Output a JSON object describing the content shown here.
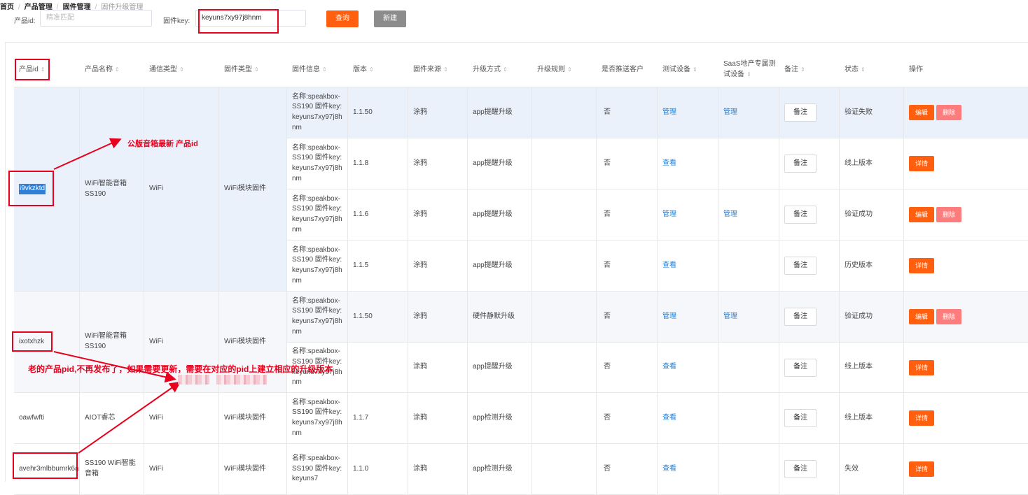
{
  "breadcrumb": {
    "home": "首页",
    "products": "产品管理",
    "firmware": "固件管理",
    "current": "固件升级管理"
  },
  "filters": {
    "product_id_label": "产品id:",
    "product_id_placeholder": "精准匹配",
    "firmware_key_label": "固件key:",
    "firmware_key_value": "keyuns7xy97j8hnm",
    "query_label": "查询",
    "new_label": "新建"
  },
  "columns": [
    "产品id",
    "产品名称",
    "通信类型",
    "固件类型",
    "固件信息",
    "版本",
    "固件来源",
    "升级方式",
    "升级规则",
    "是否推送客户",
    "测试设备",
    "SaaS地产专属测试设备",
    "备注",
    "状态",
    "操作"
  ],
  "groups": [
    {
      "pid": "i9vkzktd",
      "name": "WiFi智能音箱 SS190",
      "comm": "WiFi",
      "fwtype": "WiFi模块固件"
    },
    {
      "pid": "ixotxhzk",
      "name": "WiFi智能音箱SS190",
      "comm": "WiFi",
      "fwtype": "WiFi模块固件"
    },
    {
      "pid": "oawfwfti",
      "name": "AIOT睿芯",
      "comm": "WiFi",
      "fwtype": "WiFi模块固件"
    },
    {
      "pid": "avehr3mlbbumrk6a",
      "name": "SS190 WiFi智能音箱",
      "comm": "WiFi",
      "fwtype": "WiFi模块固件"
    }
  ],
  "rows": [
    {
      "info": "名称:speakbox-SS190 固件key:keyuns7xy97j8hnm",
      "version": "1.1.50",
      "source": "涂鸦",
      "method": "app提醒升级",
      "rule": "",
      "push": "否",
      "test": "管理",
      "saas": "管理",
      "remark": "备注",
      "status": "验证失败",
      "ops": [
        "编辑",
        "删除"
      ]
    },
    {
      "info": "名称:speakbox-SS190 固件key:keyuns7xy97j8hnm",
      "version": "1.1.8",
      "source": "涂鸦",
      "method": "app提醒升级",
      "rule": "",
      "push": "否",
      "test": "查看",
      "saas": "",
      "remark": "备注",
      "status": "线上版本",
      "ops": [
        "详情"
      ]
    },
    {
      "info": "名称:speakbox-SS190 固件key:keyuns7xy97j8hnm",
      "version": "1.1.6",
      "source": "涂鸦",
      "method": "app提醒升级",
      "rule": "",
      "push": "否",
      "test": "管理",
      "saas": "管理",
      "remark": "备注",
      "status": "验证成功",
      "ops": [
        "编辑",
        "删除"
      ]
    },
    {
      "info": "名称:speakbox-SS190 固件key:keyuns7xy97j8hnm",
      "version": "1.1.5",
      "source": "涂鸦",
      "method": "app提醒升级",
      "rule": "",
      "push": "否",
      "test": "查看",
      "saas": "",
      "remark": "备注",
      "status": "历史版本",
      "ops": [
        "详情"
      ]
    },
    {
      "info": "名称:speakbox-SS190 固件key:keyuns7xy97j8hnm",
      "version": "1.1.50",
      "source": "涂鸦",
      "method": "硬件静默升级",
      "rule": "",
      "push": "否",
      "test": "管理",
      "saas": "管理",
      "remark": "备注",
      "status": "验证成功",
      "ops": [
        "编辑",
        "删除"
      ]
    },
    {
      "info": "名称:speakbox-SS190 固件key:keyuns7xy97j8hnm",
      "version": "",
      "source": "涂鸦",
      "method": "app提醒升级",
      "rule": "",
      "push": "否",
      "test": "查看",
      "saas": "",
      "remark": "备注",
      "status": "线上版本",
      "ops": [
        "详情"
      ]
    },
    {
      "info": "名称:speakbox-SS190 固件key:keyuns7xy97j8hnm",
      "version": "1.1.7",
      "source": "涂鸦",
      "method": "app检测升级",
      "rule": "",
      "push": "否",
      "test": "查看",
      "saas": "",
      "remark": "备注",
      "status": "线上版本",
      "ops": [
        "详情"
      ]
    },
    {
      "info": "名称:speakbox-SS190 固件key:keyuns7",
      "version": "1.1.0",
      "source": "涂鸦",
      "method": "app检测升级",
      "rule": "",
      "push": "否",
      "test": "查看",
      "saas": "",
      "remark": "备注",
      "status": "失效",
      "ops": [
        "详情"
      ]
    }
  ],
  "annotations": {
    "note1": "公版音箱最新 产品id",
    "note2": "老的产品pid,不再发布了，如果需要更新，需要在对应的pid上建立相应的升级版本",
    "color": "#e8001c"
  }
}
